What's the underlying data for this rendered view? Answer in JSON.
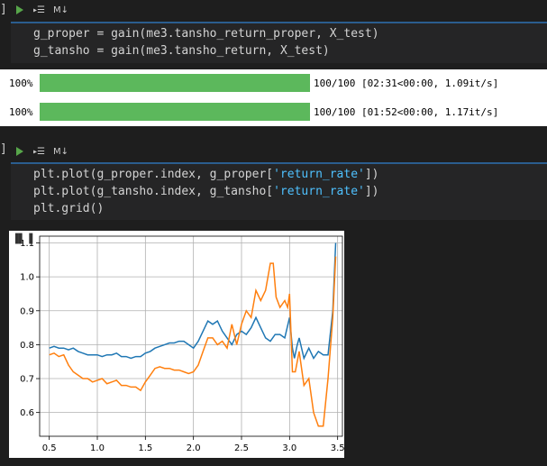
{
  "cell1": {
    "bracket": "]",
    "md_label": "M↓",
    "code": [
      {
        "parts": [
          {
            "t": "g_proper ",
            "c": ""
          },
          {
            "t": "=",
            "c": "op"
          },
          {
            "t": " gain(me3.tansho_return_proper, X_test)",
            "c": ""
          }
        ]
      },
      {
        "parts": [
          {
            "t": "g_tansho ",
            "c": ""
          },
          {
            "t": "=",
            "c": "op"
          },
          {
            "t": " gain(me3.tansho_return, X_test)",
            "c": ""
          }
        ]
      }
    ],
    "progress": [
      {
        "percent": "100%",
        "value": 1.0,
        "stats": "100/100 [02:31<00:00, 1.09it/s]"
      },
      {
        "percent": "100%",
        "value": 1.0,
        "stats": "100/100 [01:52<00:00, 1.17it/s]"
      }
    ]
  },
  "cell2": {
    "bracket": "]",
    "md_label": "M↓",
    "code": [
      {
        "parts": [
          {
            "t": "plt.plot(g_proper.index, g_proper[",
            "c": ""
          },
          {
            "t": "'return_rate'",
            "c": "str"
          },
          {
            "t": "])",
            "c": ""
          }
        ]
      },
      {
        "parts": [
          {
            "t": "plt.plot(g_tansho.index, g_tansho[",
            "c": ""
          },
          {
            "t": "'return_rate'",
            "c": "str"
          },
          {
            "t": "])",
            "c": ""
          }
        ]
      },
      {
        "parts": [
          {
            "t": "plt.grid()",
            "c": ""
          }
        ]
      }
    ]
  },
  "colors": {
    "series_blue": "#1f77b4",
    "series_orange": "#ff7f0e",
    "progress_green": "#5cb85c",
    "string_token": "#4fc1ff"
  },
  "chart_data": {
    "type": "line",
    "grid": true,
    "xlim": [
      0.4,
      3.55
    ],
    "ylim": [
      0.53,
      1.12
    ],
    "xticks": [
      0.5,
      1.0,
      1.5,
      2.0,
      2.5,
      3.0,
      3.5
    ],
    "yticks": [
      0.6,
      0.7,
      0.8,
      0.9,
      1.0,
      1.1
    ],
    "xtick_labels": [
      "0.5",
      "1.0",
      "1.5",
      "2.0",
      "2.5",
      "3.0",
      "3.5"
    ],
    "ytick_labels": [
      "0.6",
      "0.7",
      "0.8",
      "0.9",
      "1.0",
      "1.1"
    ],
    "series": [
      {
        "color": "#1f77b4",
        "x": [
          0.5,
          0.55,
          0.6,
          0.65,
          0.7,
          0.75,
          0.8,
          0.85,
          0.9,
          0.95,
          1.0,
          1.05,
          1.1,
          1.15,
          1.2,
          1.25,
          1.3,
          1.35,
          1.4,
          1.45,
          1.5,
          1.55,
          1.6,
          1.65,
          1.7,
          1.75,
          1.8,
          1.85,
          1.9,
          1.95,
          2.0,
          2.05,
          2.1,
          2.15,
          2.2,
          2.25,
          2.3,
          2.35,
          2.4,
          2.45,
          2.5,
          2.55,
          2.6,
          2.65,
          2.7,
          2.75,
          2.8,
          2.85,
          2.9,
          2.95,
          3.0,
          3.03,
          3.05,
          3.08,
          3.1,
          3.15,
          3.2,
          3.25,
          3.3,
          3.35,
          3.4,
          3.45,
          3.48
        ],
        "y": [
          0.79,
          0.795,
          0.79,
          0.79,
          0.785,
          0.79,
          0.78,
          0.775,
          0.77,
          0.77,
          0.77,
          0.765,
          0.77,
          0.77,
          0.775,
          0.765,
          0.765,
          0.76,
          0.765,
          0.765,
          0.775,
          0.78,
          0.79,
          0.795,
          0.8,
          0.805,
          0.805,
          0.81,
          0.81,
          0.8,
          0.79,
          0.81,
          0.84,
          0.87,
          0.86,
          0.87,
          0.84,
          0.82,
          0.8,
          0.83,
          0.84,
          0.83,
          0.85,
          0.88,
          0.85,
          0.82,
          0.81,
          0.83,
          0.83,
          0.82,
          0.88,
          0.79,
          0.76,
          0.8,
          0.82,
          0.76,
          0.79,
          0.76,
          0.78,
          0.77,
          0.77,
          0.9,
          1.1
        ]
      },
      {
        "color": "#ff7f0e",
        "x": [
          0.5,
          0.55,
          0.6,
          0.65,
          0.7,
          0.75,
          0.8,
          0.85,
          0.9,
          0.95,
          1.0,
          1.05,
          1.1,
          1.15,
          1.2,
          1.25,
          1.3,
          1.35,
          1.4,
          1.45,
          1.5,
          1.55,
          1.6,
          1.65,
          1.7,
          1.75,
          1.8,
          1.85,
          1.9,
          1.95,
          2.0,
          2.05,
          2.1,
          2.15,
          2.2,
          2.25,
          2.3,
          2.35,
          2.4,
          2.45,
          2.5,
          2.55,
          2.6,
          2.65,
          2.7,
          2.75,
          2.8,
          2.83,
          2.86,
          2.9,
          2.95,
          2.98,
          3.0,
          3.03,
          3.06,
          3.1,
          3.15,
          3.2,
          3.25,
          3.3,
          3.35,
          3.4,
          3.45,
          3.48
        ],
        "y": [
          0.77,
          0.775,
          0.765,
          0.77,
          0.74,
          0.72,
          0.71,
          0.7,
          0.7,
          0.69,
          0.695,
          0.7,
          0.685,
          0.69,
          0.695,
          0.68,
          0.68,
          0.675,
          0.675,
          0.665,
          0.69,
          0.71,
          0.73,
          0.735,
          0.73,
          0.73,
          0.725,
          0.725,
          0.72,
          0.715,
          0.72,
          0.74,
          0.78,
          0.82,
          0.82,
          0.8,
          0.81,
          0.79,
          0.86,
          0.8,
          0.86,
          0.9,
          0.88,
          0.96,
          0.93,
          0.96,
          1.04,
          1.04,
          0.94,
          0.91,
          0.93,
          0.91,
          0.95,
          0.72,
          0.72,
          0.78,
          0.68,
          0.7,
          0.6,
          0.56,
          0.56,
          0.7,
          0.88,
          1.06
        ]
      }
    ]
  }
}
